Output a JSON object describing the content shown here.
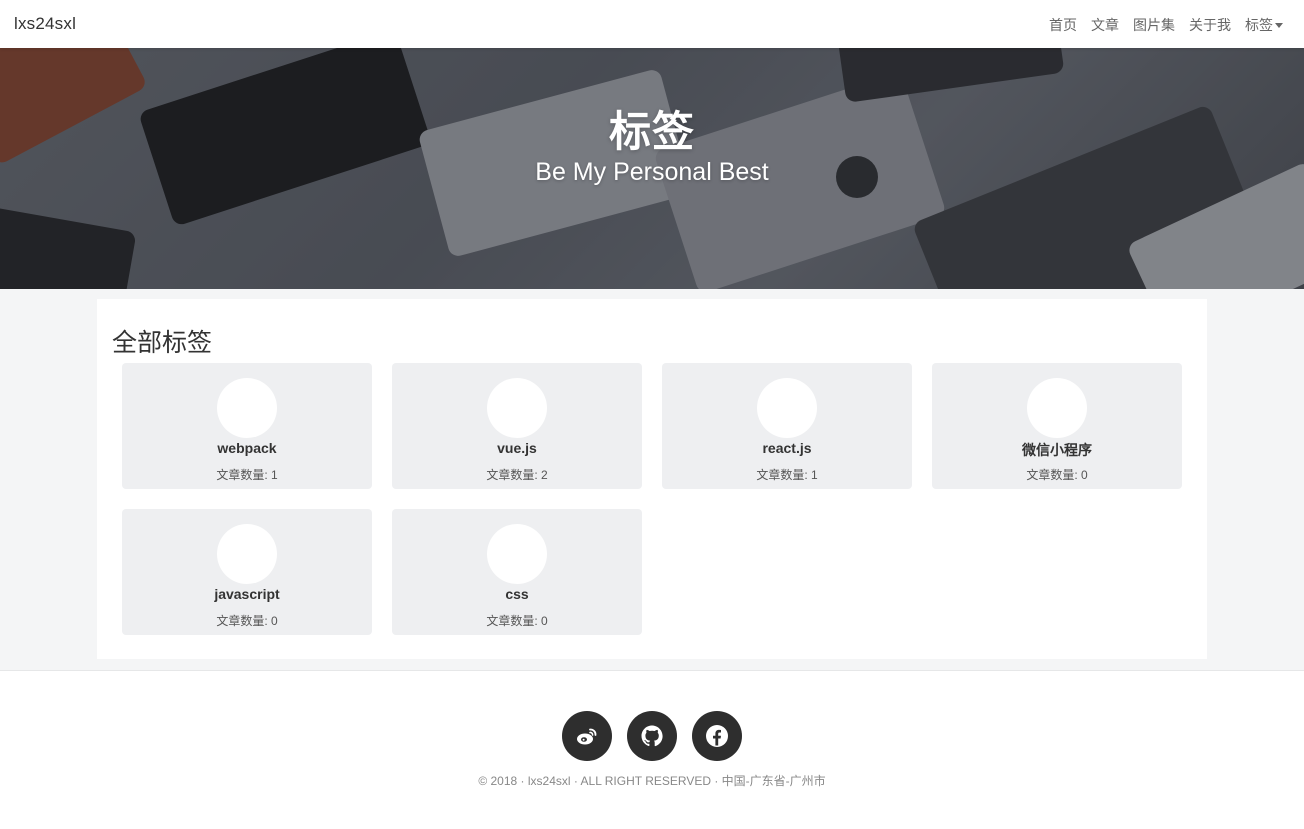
{
  "nav": {
    "brand": "lxs24sxl",
    "links": [
      "首页",
      "文章",
      "图片集",
      "关于我"
    ],
    "dropdown_label": "标签"
  },
  "hero": {
    "title": "标签",
    "subtitle": "Be My Personal Best"
  },
  "tags": {
    "heading": "全部标签",
    "items": [
      {
        "name": "webpack",
        "count_text": "文章数量: 1"
      },
      {
        "name": "vue.js",
        "count_text": "文章数量: 2"
      },
      {
        "name": "react.js",
        "count_text": "文章数量: 1"
      },
      {
        "name": "微信小程序",
        "count_text": "文章数量: 0"
      },
      {
        "name": "javascript",
        "count_text": "文章数量: 0"
      },
      {
        "name": "css",
        "count_text": "文章数量: 0"
      }
    ]
  },
  "footer": {
    "social_icons": [
      "weibo-icon",
      "github-icon",
      "facebook-icon"
    ],
    "copyright": "© 2018 · lxs24sxl · ALL RIGHT RESERVED · 中国-广东省-广州市"
  },
  "colors": {
    "text_dark": "#333333",
    "card_bg": "#eeeff1",
    "page_bg": "#f4f5f6",
    "social_bg": "#2e2e2e"
  }
}
